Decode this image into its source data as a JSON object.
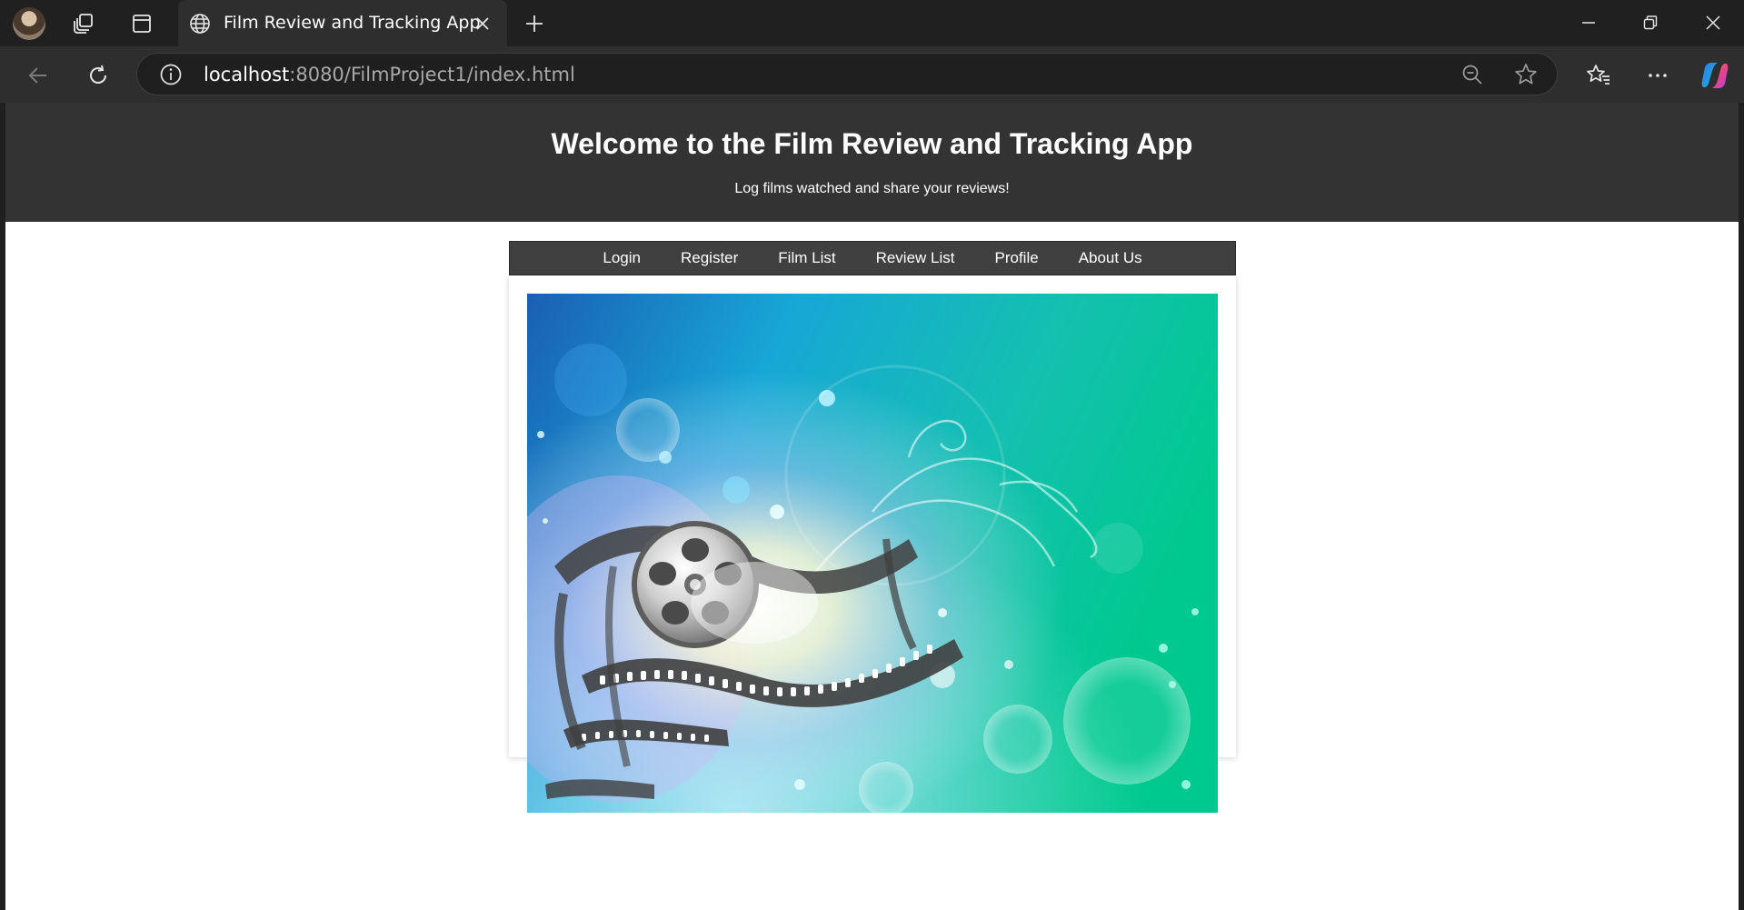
{
  "browser": {
    "tab_title": "Film Review and Tracking App",
    "url_host": "localhost",
    "url_rest": ":8080/FilmProject1/index.html",
    "icons": {
      "profile": "profile-avatar",
      "workspaces": "workspaces-icon",
      "tab_actions": "tab-actions-icon",
      "tab_favicon": "globe-icon",
      "close_tab": "close-icon",
      "new_tab": "plus-icon",
      "minimize": "minimize-icon",
      "restore": "restore-icon",
      "close_window": "close-icon",
      "back": "back-arrow-icon",
      "refresh": "refresh-icon",
      "site_info": "info-icon",
      "zoom": "zoom-out-icon",
      "favorite": "star-icon",
      "favorites": "favorites-icon",
      "more": "more-icon",
      "copilot": "copilot-icon"
    }
  },
  "page": {
    "title": "Welcome to the Film Review and Tracking App",
    "subtitle": "Log films watched and share your reviews!",
    "nav": {
      "login": "Login",
      "register": "Register",
      "film_list": "Film List",
      "review_list": "Review List",
      "profile": "Profile",
      "about_us": "About Us"
    },
    "hero_image": "film-reel-banner",
    "colors": {
      "header_bg": "#333333",
      "nav_bg": "#404040",
      "hero_teal": "#00c9a0",
      "hero_blue": "#1a78c8"
    }
  }
}
